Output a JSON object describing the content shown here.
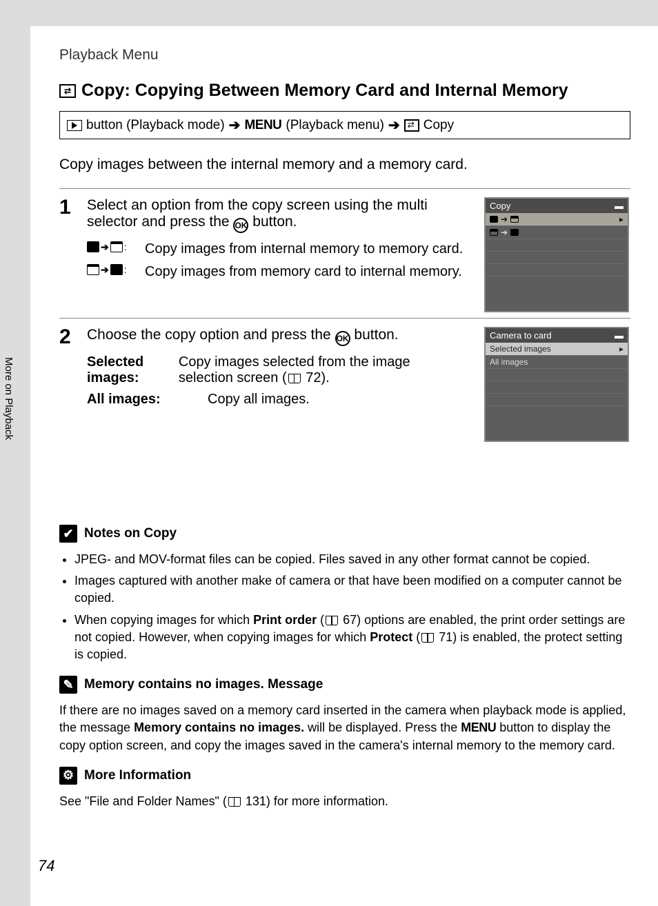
{
  "header": {
    "section": "Playback Menu"
  },
  "title": {
    "text": "Copy: Copying Between Memory Card and Internal Memory"
  },
  "breadcrumb": {
    "part1": "button (Playback mode)",
    "menu_label": "MENU",
    "part2": "(Playback menu)",
    "copy_label": "Copy"
  },
  "intro": "Copy images between the internal memory and a memory card.",
  "steps": {
    "s1": {
      "num": "1",
      "text_a": "Select an option from the copy screen using the multi selector and press the ",
      "text_b": " button.",
      "opt1": "Copy images from internal memory to memory card.",
      "opt2": "Copy images from memory card to internal memory.",
      "lcd_title": "Copy"
    },
    "s2": {
      "num": "2",
      "text_a": "Choose the copy option and press the ",
      "text_b": " button.",
      "def1_term": "Selected images:",
      "def1_val_a": "Copy images selected from the image selection screen (",
      "def1_val_b": " 72).",
      "def2_term": "All images:",
      "def2_val": "Copy all images.",
      "lcd_title": "Camera to card",
      "lcd_row1": "Selected images",
      "lcd_row2": "All images"
    }
  },
  "notes": {
    "h1": "Notes on Copy",
    "b1": "JPEG- and MOV-format files can be copied. Files saved in any other format cannot be copied.",
    "b2": "Images captured with another make of camera or that have been modified on a computer cannot be copied.",
    "b3_a": "When copying images for which ",
    "b3_bold1": "Print order",
    "b3_b": " (",
    "b3_c": " 67) options are enabled, the print order settings are not copied. However, when copying images for which ",
    "b3_bold2": "Protect",
    "b3_d": " (",
    "b3_e": " 71) is enabled, the protect setting is copied.",
    "h2": "Memory contains no images. Message",
    "p2_a": "If there are no images saved on a memory card inserted in the camera when playback mode is applied, the message ",
    "p2_bold": "Memory contains no images.",
    "p2_b": " will be displayed. Press the ",
    "p2_menu": "MENU",
    "p2_c": " button to display the copy option screen, and copy the images saved in the camera's internal memory to the memory card.",
    "h3": "More Information",
    "p3_a": "See \"File and Folder Names\" (",
    "p3_b": " 131) for more information."
  },
  "side_tab": "More on Playback",
  "page_number": "74"
}
